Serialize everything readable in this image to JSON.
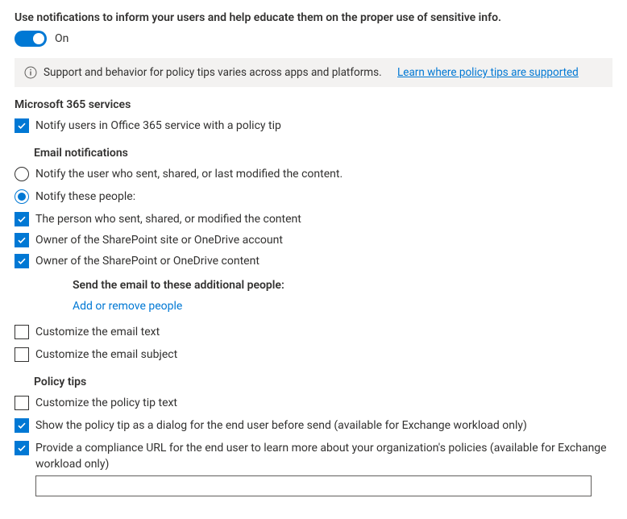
{
  "header": {
    "description": "Use notifications to inform your users and help educate them on the proper use of sensitive info.",
    "toggle_label": "On"
  },
  "info_bar": {
    "text": "Support and behavior for policy tips varies across apps and platforms.",
    "link_text": "Learn where policy tips are supported"
  },
  "services_heading": "Microsoft 365 services",
  "notify_checkbox_label": "Notify users in Office 365 service with a policy tip",
  "email_section": {
    "title": "Email notifications",
    "radio_sender": "Notify the user who sent, shared, or last modified the content.",
    "radio_people": "Notify these people:",
    "cb_person": "The person who sent, shared, or modified the content",
    "cb_site_owner": "Owner of the SharePoint site or OneDrive account",
    "cb_content_owner": "Owner of the SharePoint or OneDrive content",
    "additional_heading": "Send the email to these additional people:",
    "add_people_link": "Add or remove people",
    "cb_custom_text": "Customize the email text",
    "cb_custom_subject": "Customize the email subject"
  },
  "tips_section": {
    "title": "Policy tips",
    "cb_custom_tip": "Customize the policy tip text",
    "cb_dialog": "Show the policy tip as a dialog for the end user before send (available for Exchange workload only)",
    "cb_url": "Provide a compliance URL for the end user to learn more about your organization's policies (available for Exchange workload only)",
    "url_value": ""
  }
}
